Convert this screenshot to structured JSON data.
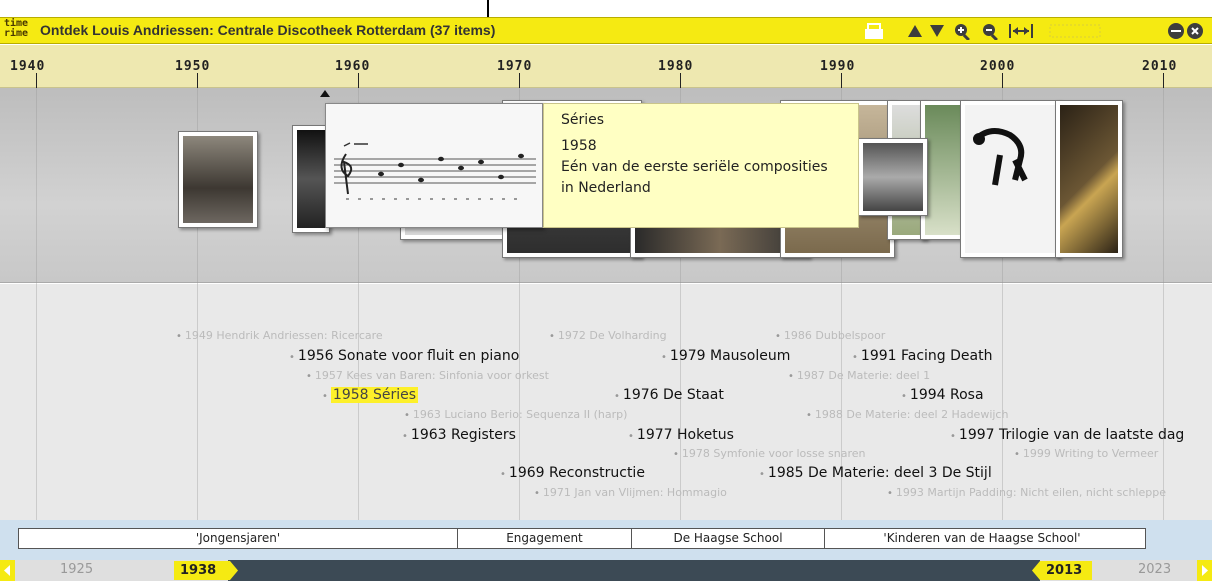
{
  "app": {
    "logo_line1": "time",
    "logo_line2": "rime",
    "title": "Ontdek Louis Andriessen: Centrale Discotheek Rotterdam  (37 items)"
  },
  "ruler": {
    "years": [
      "1940",
      "1950",
      "1960",
      "1970",
      "1980",
      "1990",
      "2000",
      "2010"
    ]
  },
  "tooltip": {
    "title": "Séries",
    "year": "1958",
    "text": "Eén van de eerste seriële composities in Nederland"
  },
  "events": [
    {
      "label": "1949 Hendrik Andriessen: Ricercare",
      "kind": "minor"
    },
    {
      "label": "1972 De Volharding",
      "kind": "minor"
    },
    {
      "label": "1986 Dubbelspoor",
      "kind": "minor"
    },
    {
      "label": "1956 Sonate voor fluit en piano",
      "kind": "major"
    },
    {
      "label": "1979 Mausoleum",
      "kind": "major"
    },
    {
      "label": "1991 Facing Death",
      "kind": "major"
    },
    {
      "label": "1957 Kees van Baren: Sinfonia voor orkest",
      "kind": "minor"
    },
    {
      "label": "1987 De Materie: deel 1",
      "kind": "minor"
    },
    {
      "label": "1958 Séries",
      "kind": "major",
      "selected": true
    },
    {
      "label": "1976 De Staat",
      "kind": "major"
    },
    {
      "label": "1994 Rosa",
      "kind": "major"
    },
    {
      "label": "1963 Luciano Berio: Sequenza II (harp)",
      "kind": "minor"
    },
    {
      "label": "1988 De Materie: deel 2 Hadewijch",
      "kind": "minor"
    },
    {
      "label": "1963 Registers",
      "kind": "major"
    },
    {
      "label": "1977 Hoketus",
      "kind": "major"
    },
    {
      "label": "1997 Trilogie van de laatste dag",
      "kind": "major"
    },
    {
      "label": "1978 Symfonie voor losse snaren",
      "kind": "minor"
    },
    {
      "label": "1999 Writing to Vermeer",
      "kind": "minor"
    },
    {
      "label": "1969 Reconstructie",
      "kind": "major"
    },
    {
      "label": "1985 De Materie: deel 3 De Stijl",
      "kind": "major"
    },
    {
      "label": "1971 Jan van Vlijmen: Hommagio",
      "kind": "minor"
    },
    {
      "label": "1993 Martijn Padding: Nicht eilen, nicht schleppe",
      "kind": "minor"
    }
  ],
  "periods": [
    "'Jongensjaren'",
    "Engagement",
    "De Haagse School",
    "'Kinderen van de Haagse School'"
  ],
  "navigator": {
    "start_year": "1925",
    "view_start": "1938",
    "view_end": "2013",
    "end_year": "2023"
  },
  "colors": {
    "accent": "#f5ea12",
    "tooltip_bg": "#ffffc3",
    "navigator_dark": "#3c4a55"
  }
}
